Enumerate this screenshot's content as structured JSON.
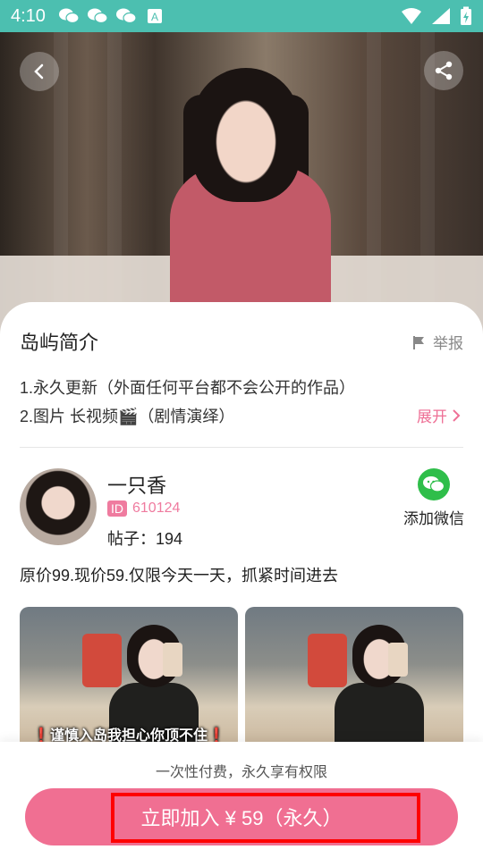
{
  "status_bar": {
    "time": "4:10",
    "icons": [
      "wechat-icon",
      "wechat-icon",
      "wechat-icon",
      "a-icon"
    ],
    "right_icons": [
      "wifi-icon",
      "signal-icon",
      "battery-charging-icon"
    ],
    "color": "#4cbfb0"
  },
  "hero": {
    "back_icon": "chevron-left-icon",
    "share_icon": "share-icon"
  },
  "intro": {
    "title": "岛屿简介",
    "report_label": "举报",
    "line1": "1.永久更新（外面任何平台都不会公开的作品）",
    "line2": "2.图片 长视频🎬（剧情演绎）",
    "expand_label": "展开"
  },
  "profile": {
    "name": "一只香",
    "id_badge": "ID",
    "id_value": "610124",
    "posts_label": "帖子：194",
    "wechat_label": "添加微信",
    "promo": "原价99.现价59.仅限今天一天，抓紧时间进去"
  },
  "gallery": {
    "items": [
      {
        "caption": "❗谨慎入岛我担心你顶不住❗"
      },
      {
        "caption": ""
      }
    ]
  },
  "footer": {
    "note": "一次性付费，永久享有权限",
    "join_label": "立即加入 ¥ 59（永久）",
    "accent": "#f06f92"
  }
}
